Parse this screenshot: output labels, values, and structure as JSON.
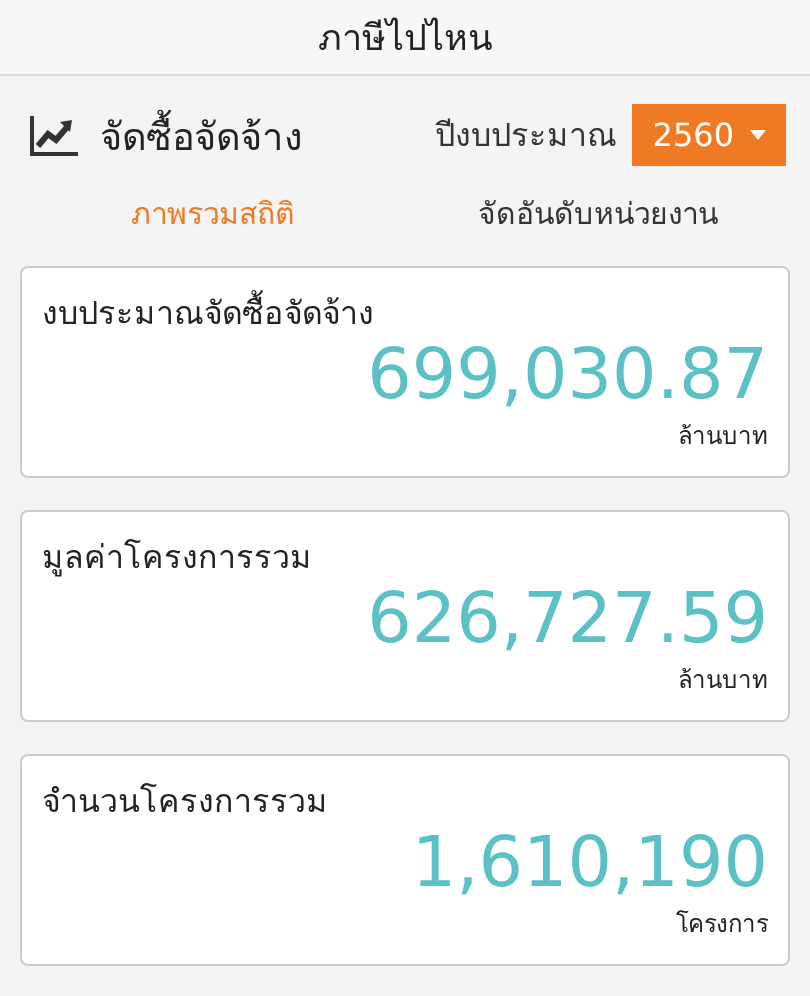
{
  "header": {
    "title": "ภาษีไปไหน"
  },
  "section": {
    "title": "จัดซื้อจัดจ้าง",
    "year_label": "ปีงบประมาณ",
    "year": "2560"
  },
  "tabs": [
    {
      "label": "ภาพรวมสถิติ",
      "selected": true
    },
    {
      "label": "จัดอันดับหน่วยงาน",
      "selected": false
    }
  ],
  "cards": [
    {
      "title": "งบประมาณจัดซื้อจัดจ้าง",
      "value": "699,030.87",
      "unit": "ล้านบาท"
    },
    {
      "title": "มูลค่าโครงการรวม",
      "value": "626,727.59",
      "unit": "ล้านบาท"
    },
    {
      "title": "จำนวนโครงการรวม",
      "value": "1,610,190",
      "unit": "โครงการ"
    }
  ]
}
